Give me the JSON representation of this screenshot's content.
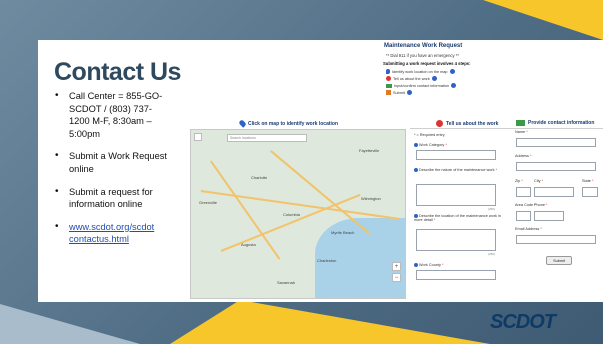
{
  "slide": {
    "title": "Contact Us",
    "bullets": [
      {
        "text": "Call Center = 855-GO-SCDOT / (803) 737-1200 M-F, 8:30am – 5:00pm"
      },
      {
        "text": "Submit a Work Request online"
      },
      {
        "text": "Submit a request for information online"
      },
      {
        "text": "www.scdot.org/scdot contactus.html",
        "link": true
      }
    ]
  },
  "form": {
    "title": "Maintenance Work Request",
    "emergency": "** Dial 911 if you have an emergency **",
    "steps_heading": "Submitting a work request involves 4 steps:",
    "steps": [
      "Identify work location on the map",
      "Tell us about the work",
      "Input/confirm contact information",
      "Submit"
    ],
    "map_heading": "Click on map to identify work location",
    "map_search_placeholder": "Search locations",
    "map_cities": [
      "Fayetteville",
      "Charlotte",
      "Greenville",
      "Columbia",
      "Augusta",
      "Savannah",
      "Wilmington",
      "Myrtle Beach",
      "Charleston"
    ],
    "work_heading": "Tell us about the work",
    "required_note": "* = Required entry",
    "work_category": "Work Category",
    "describe_nature": "Describe the nature of the maintenance work",
    "describe_location": "Describe the location of the maintenance work in more detail",
    "work_county": "Work County",
    "char_limit": "(250)",
    "contact_heading": "Provide contact information",
    "name": "Name",
    "address": "Address",
    "zip": "Zip",
    "city": "City",
    "state": "State",
    "area_code": "Area Code",
    "phone": "Phone",
    "email": "Email Address",
    "submit": "Submit"
  },
  "logo": "SCDOT",
  "colors": {
    "navy": "#2f4a5f",
    "yellow": "#f7c62b",
    "link": "#1f4fb0"
  }
}
